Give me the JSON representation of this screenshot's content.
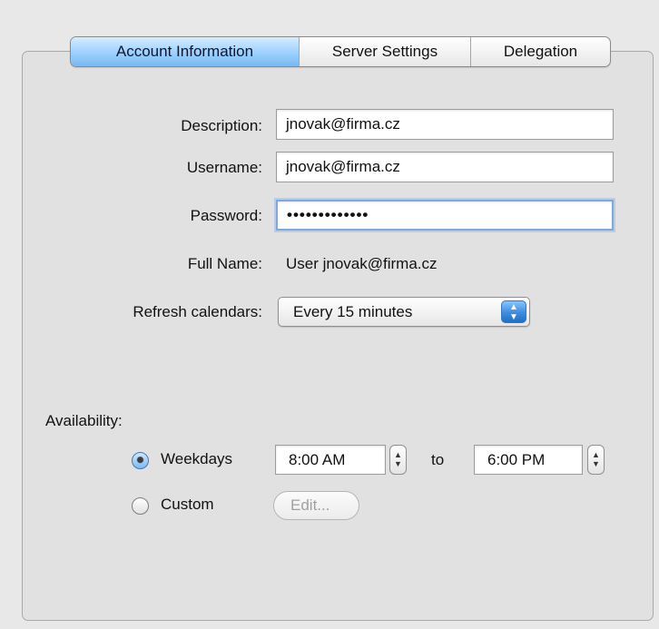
{
  "tabs": [
    {
      "label": "Account Information"
    },
    {
      "label": "Server Settings"
    },
    {
      "label": "Delegation"
    }
  ],
  "form": {
    "description_label": "Description:",
    "description_value": "jnovak@firma.cz",
    "username_label": "Username:",
    "username_value": "jnovak@firma.cz",
    "password_label": "Password:",
    "password_value": "•••••••••••••",
    "fullname_label": "Full Name:",
    "fullname_value": "User jnovak@firma.cz",
    "refresh_label": "Refresh calendars:",
    "refresh_value": "Every 15 minutes"
  },
  "availability": {
    "heading": "Availability:",
    "weekdays_label": "Weekdays",
    "start_time": "8:00 AM",
    "to_label": "to",
    "end_time": "6:00 PM",
    "custom_label": "Custom",
    "edit_button": "Edit..."
  },
  "icons": {
    "popup_arrows": "up-down-arrows-icon",
    "stepper": "stepper-icon"
  },
  "colors": {
    "selected_tab": "#9bd0ff",
    "focus_ring": "#7fa9dd",
    "popup_arrow": "#3c8cdf"
  }
}
